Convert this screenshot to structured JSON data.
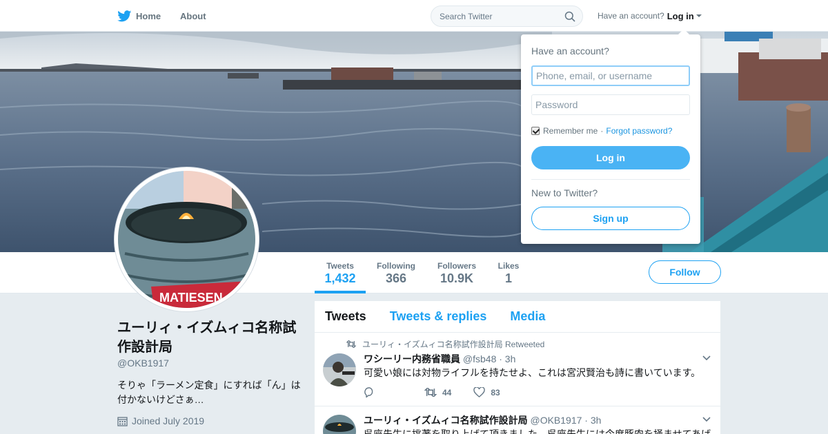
{
  "colors": {
    "accent": "#1da1f2",
    "text": "#14171a",
    "muted": "#657786",
    "background": "#e6ecf0"
  },
  "nav": {
    "home_label": "Home",
    "home_icon": "twitter-bird-icon",
    "about_label": "About",
    "search_placeholder": "Search Twitter",
    "search_icon": "magnifier-icon",
    "have_account": "Have an account?",
    "login_label": "Log in"
  },
  "profile_nav": {
    "stats": [
      {
        "label": "Tweets",
        "value": "1,432"
      },
      {
        "label": "Following",
        "value": "366"
      },
      {
        "label": "Followers",
        "value": "10.9K"
      },
      {
        "label": "Likes",
        "value": "1"
      }
    ],
    "follow_label": "Follow"
  },
  "profile": {
    "name": "ユーリィ・イズムィコ名称試作設計局",
    "handle": "@OKB1917",
    "bio": "そりゃ「ラーメン定食」にすれば「ん」は付かないけどさぁ…",
    "joined": "Joined July 2019",
    "avatar_text": "MATIESEN"
  },
  "timeline": {
    "tabs": [
      "Tweets",
      "Tweets & replies",
      "Media"
    ],
    "tweets": [
      {
        "retweeted_by": "ユーリィ・イズムィコ名称試作設計局 Retweeted",
        "author": "ワシーリー内務省職員",
        "handle": "@fsb48",
        "time": "· 3h",
        "text": "可愛い娘には対物ライフルを持たせよ、これは宮沢賢治も詩に書いています。",
        "retweets": "44",
        "likes": "83"
      },
      {
        "author": "ユーリィ・イズムィコ名称試作設計局",
        "handle": "@OKB1917",
        "time": "· 3h",
        "text": "呉座先生に挑著を取り上げて頂きました。呉座先生には今度豚肉を掻ませてあげ"
      }
    ]
  },
  "login_dropdown": {
    "title": "Have an account?",
    "username_placeholder": "Phone, email, or username",
    "password_placeholder": "Password",
    "remember_label": "Remember me",
    "separator": "·",
    "forgot_label": "Forgot password?",
    "login_button": "Log in",
    "new_label": "New to Twitter?",
    "signup_button": "Sign up"
  }
}
